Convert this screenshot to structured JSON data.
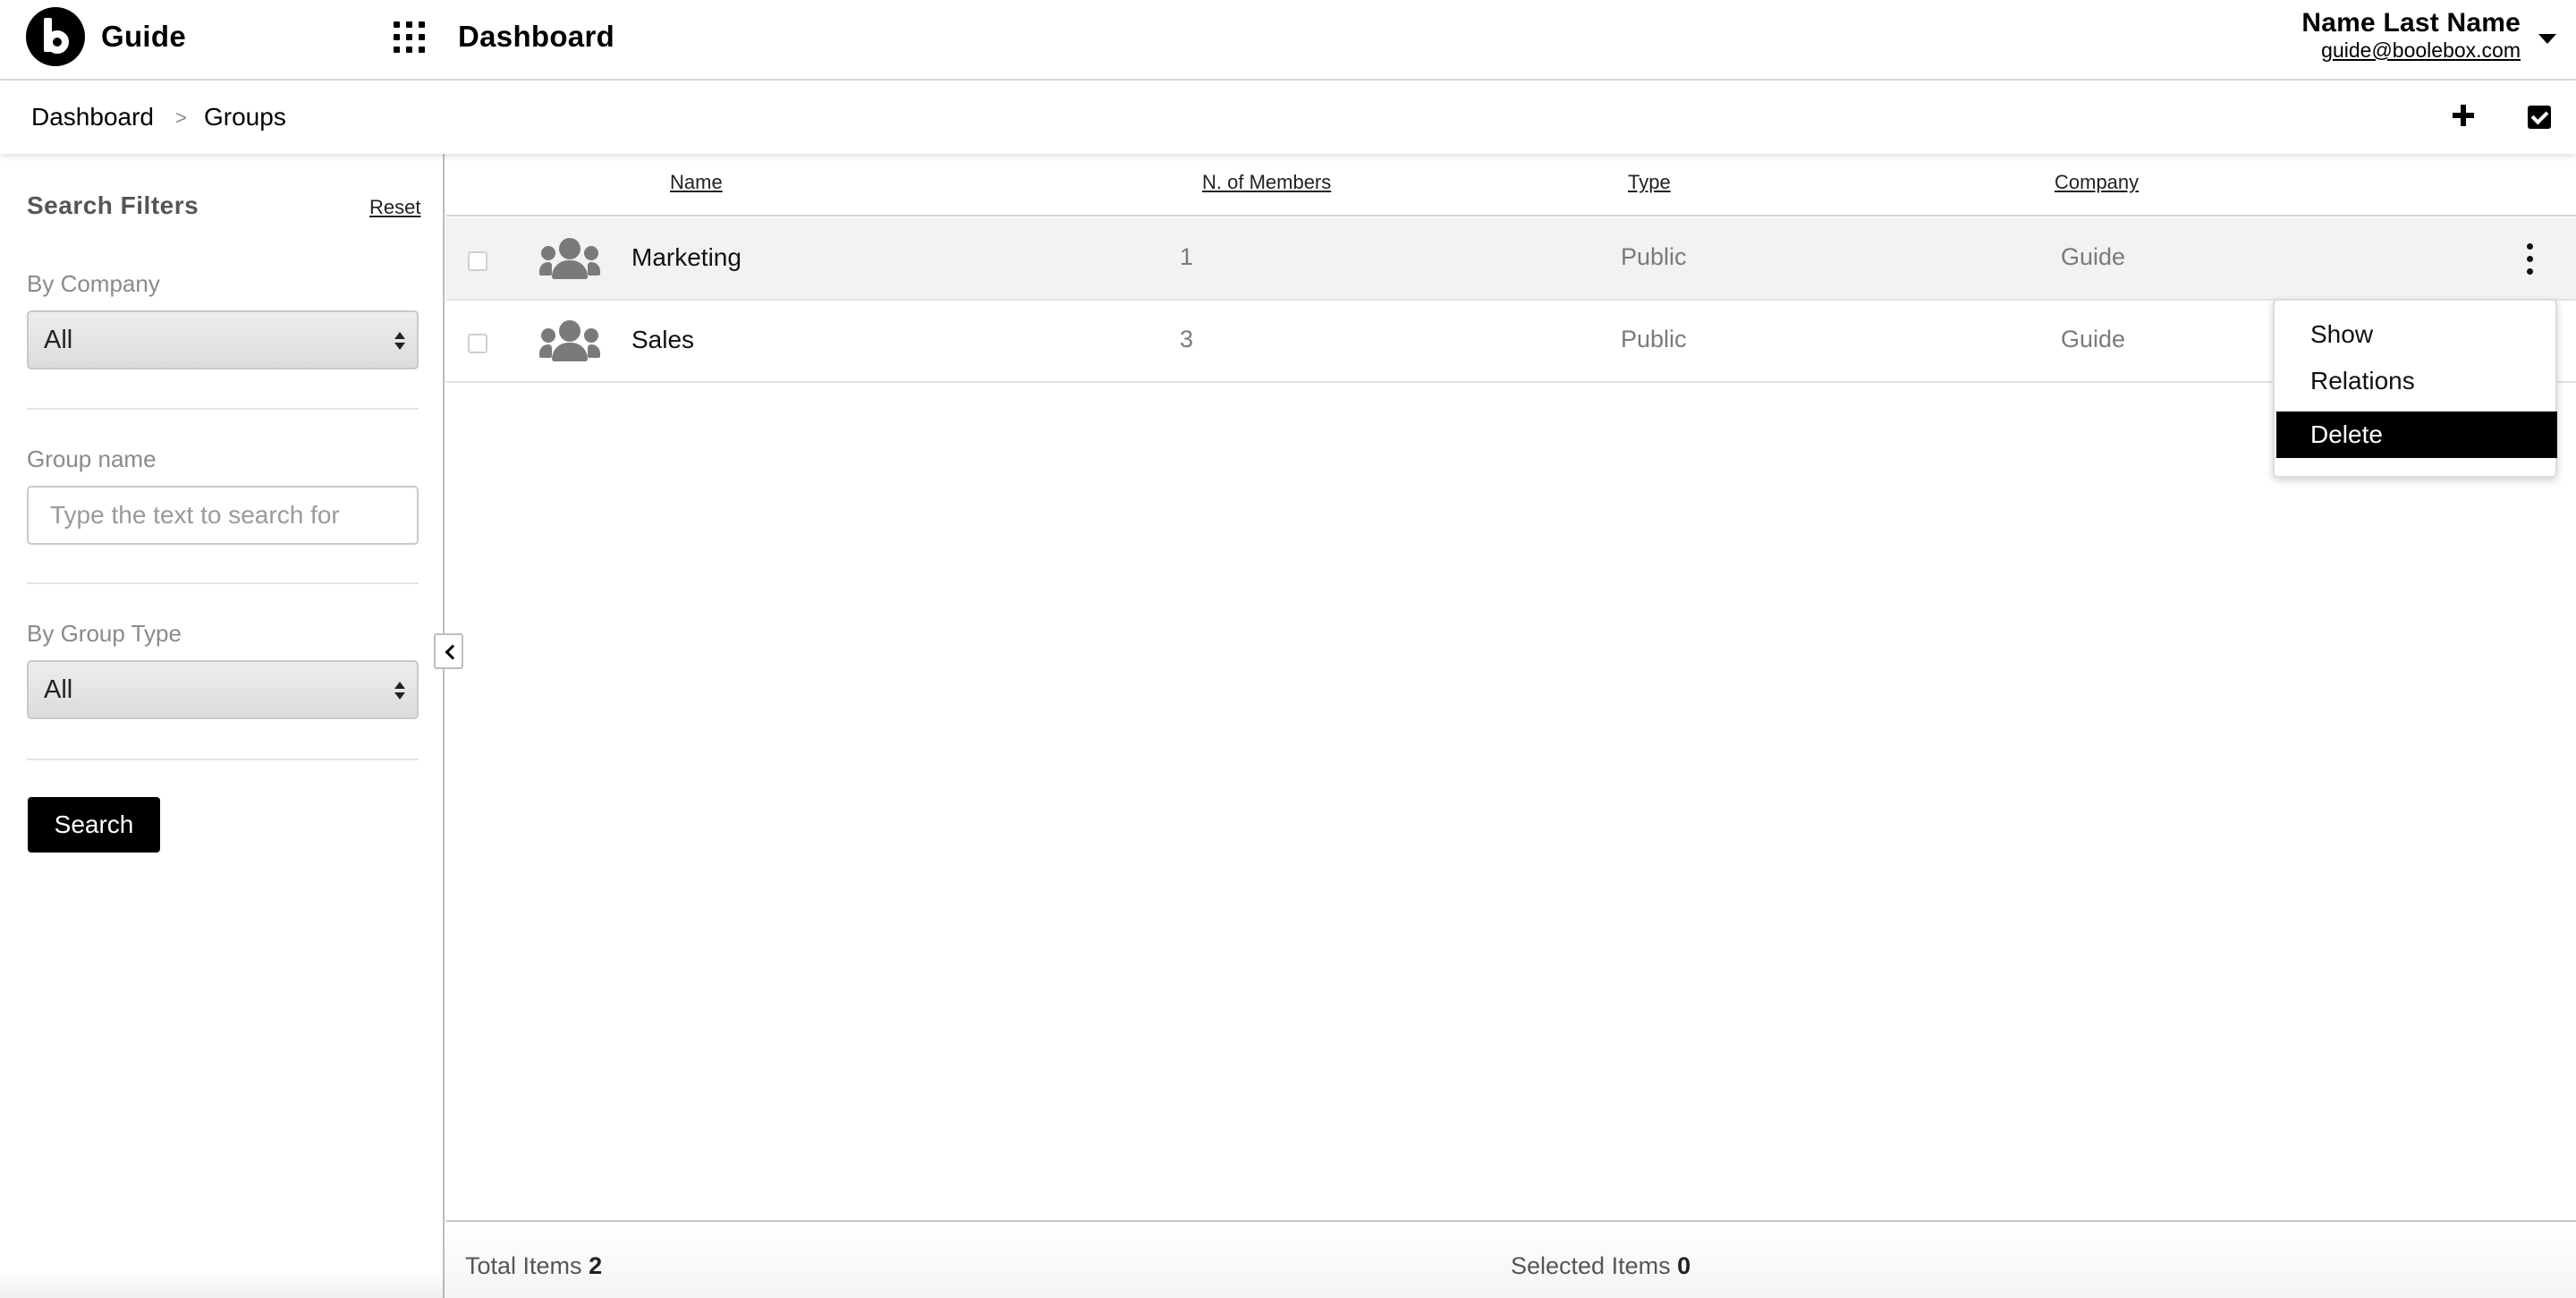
{
  "header": {
    "app_name": "Guide",
    "page_title": "Dashboard",
    "user_name": "Name Last Name",
    "user_email": "guide@boolebox.com"
  },
  "breadcrumb": {
    "items": [
      "Dashboard",
      "Groups"
    ],
    "separator": ">"
  },
  "filters": {
    "title": "Search Filters",
    "reset_label": "Reset",
    "company_label": "By Company",
    "company_value": "All",
    "group_name_label": "Group name",
    "group_name_placeholder": "Type the text to search for",
    "group_type_label": "By Group Type",
    "group_type_value": "All",
    "search_label": "Search"
  },
  "table": {
    "columns": [
      "Name",
      "N. of Members",
      "Type",
      "Company"
    ],
    "rows": [
      {
        "name": "Marketing",
        "members": "1",
        "type": "Public",
        "company": "Guide"
      },
      {
        "name": "Sales",
        "members": "3",
        "type": "Public",
        "company": "Guide"
      }
    ]
  },
  "row_menu": {
    "items": [
      "Show",
      "Relations",
      "Delete"
    ],
    "active": "Delete"
  },
  "footer": {
    "total_label": "Total Items",
    "total_value": "2",
    "selected_label": "Selected Items",
    "selected_value": "0"
  },
  "icons": {
    "logo": "boolebox-b-logo",
    "apps": "apps-grid-icon",
    "add": "plus-icon",
    "select": "check-square-icon",
    "group": "users-icon",
    "more": "kebab-vertical-icon",
    "collapse": "chevron-left-icon"
  }
}
